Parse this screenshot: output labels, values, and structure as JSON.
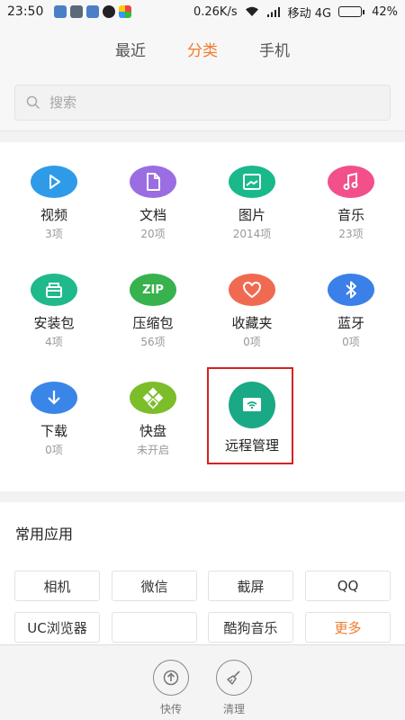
{
  "status_bar": {
    "time": "23:50",
    "speed": "0.26K/s",
    "carrier": "移动 4G",
    "battery": "42%",
    "battery_level": 0.42
  },
  "tabs": [
    {
      "label": "最近",
      "active": false
    },
    {
      "label": "分类",
      "active": true
    },
    {
      "label": "手机",
      "active": false
    }
  ],
  "search": {
    "placeholder": "搜索"
  },
  "categories": [
    {
      "label": "视频",
      "count": "3项",
      "color": "#2f9be8",
      "icon": "play-icon"
    },
    {
      "label": "文档",
      "count": "20项",
      "color": "#9b6de2",
      "icon": "document-icon"
    },
    {
      "label": "图片",
      "count": "2014项",
      "color": "#19b98b",
      "icon": "image-icon"
    },
    {
      "label": "音乐",
      "count": "23项",
      "color": "#f2508a",
      "icon": "music-icon"
    },
    {
      "label": "安装包",
      "count": "4项",
      "color": "#1fb98c",
      "icon": "package-icon"
    },
    {
      "label": "压缩包",
      "count": "56项",
      "color": "#37b24d",
      "icon": "zip-icon",
      "icon_text": "ZIP"
    },
    {
      "label": "收藏夹",
      "count": "0项",
      "color": "#f06a52",
      "icon": "heart-icon"
    },
    {
      "label": "蓝牙",
      "count": "0项",
      "color": "#3a80e8",
      "icon": "bluetooth-icon"
    },
    {
      "label": "下载",
      "count": "0项",
      "color": "#3a86e8",
      "icon": "download-icon"
    },
    {
      "label": "快盘",
      "count": "未开启",
      "color": "#7cbd2a",
      "icon": "kuaipan-icon"
    },
    {
      "label": "远程管理",
      "count": "",
      "color": "#1aa985",
      "icon": "remote-wifi-icon"
    }
  ],
  "apps": {
    "title": "常用应用",
    "items": [
      "相机",
      "微信",
      "截屏",
      "QQ",
      "UC浏览器",
      "",
      "酷狗音乐",
      "更多"
    ]
  },
  "bottom_tools": [
    {
      "label": "快传",
      "icon": "send-icon"
    },
    {
      "label": "清理",
      "icon": "broom-icon"
    }
  ],
  "colors": {
    "accent": "#f07b2c",
    "highlight_border": "#d22222"
  }
}
